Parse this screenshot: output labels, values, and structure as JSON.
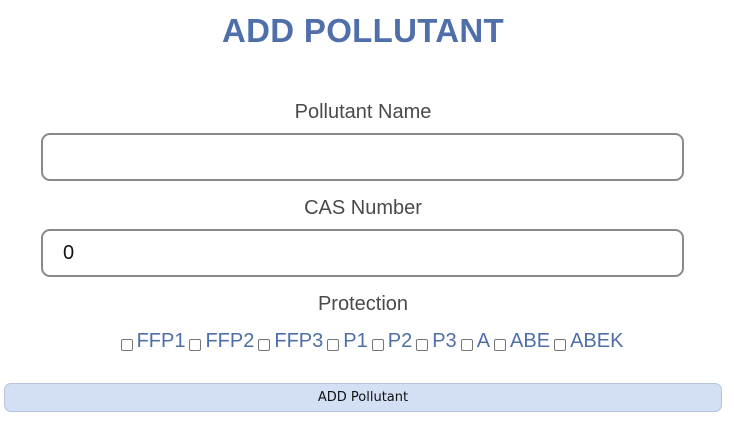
{
  "page": {
    "title": "ADD POLLUTANT"
  },
  "form": {
    "pollutant_name": {
      "label": "Pollutant Name",
      "value": ""
    },
    "cas_number": {
      "label": "CAS Number",
      "value": "0"
    },
    "protection": {
      "label": "Protection",
      "options": [
        {
          "label": "FFP1",
          "checked": false
        },
        {
          "label": "FFP2",
          "checked": false
        },
        {
          "label": "FFP3",
          "checked": false
        },
        {
          "label": "P1",
          "checked": false
        },
        {
          "label": "P2",
          "checked": false
        },
        {
          "label": "P3",
          "checked": false
        },
        {
          "label": "A",
          "checked": false
        },
        {
          "label": "ABE",
          "checked": false
        },
        {
          "label": "ABEK",
          "checked": false
        }
      ]
    },
    "submit_label": "ADD Pollutant"
  },
  "colors": {
    "accent": "#4f6faa",
    "button_bg": "#d3dff5",
    "field_border": "#8a8a8a"
  }
}
